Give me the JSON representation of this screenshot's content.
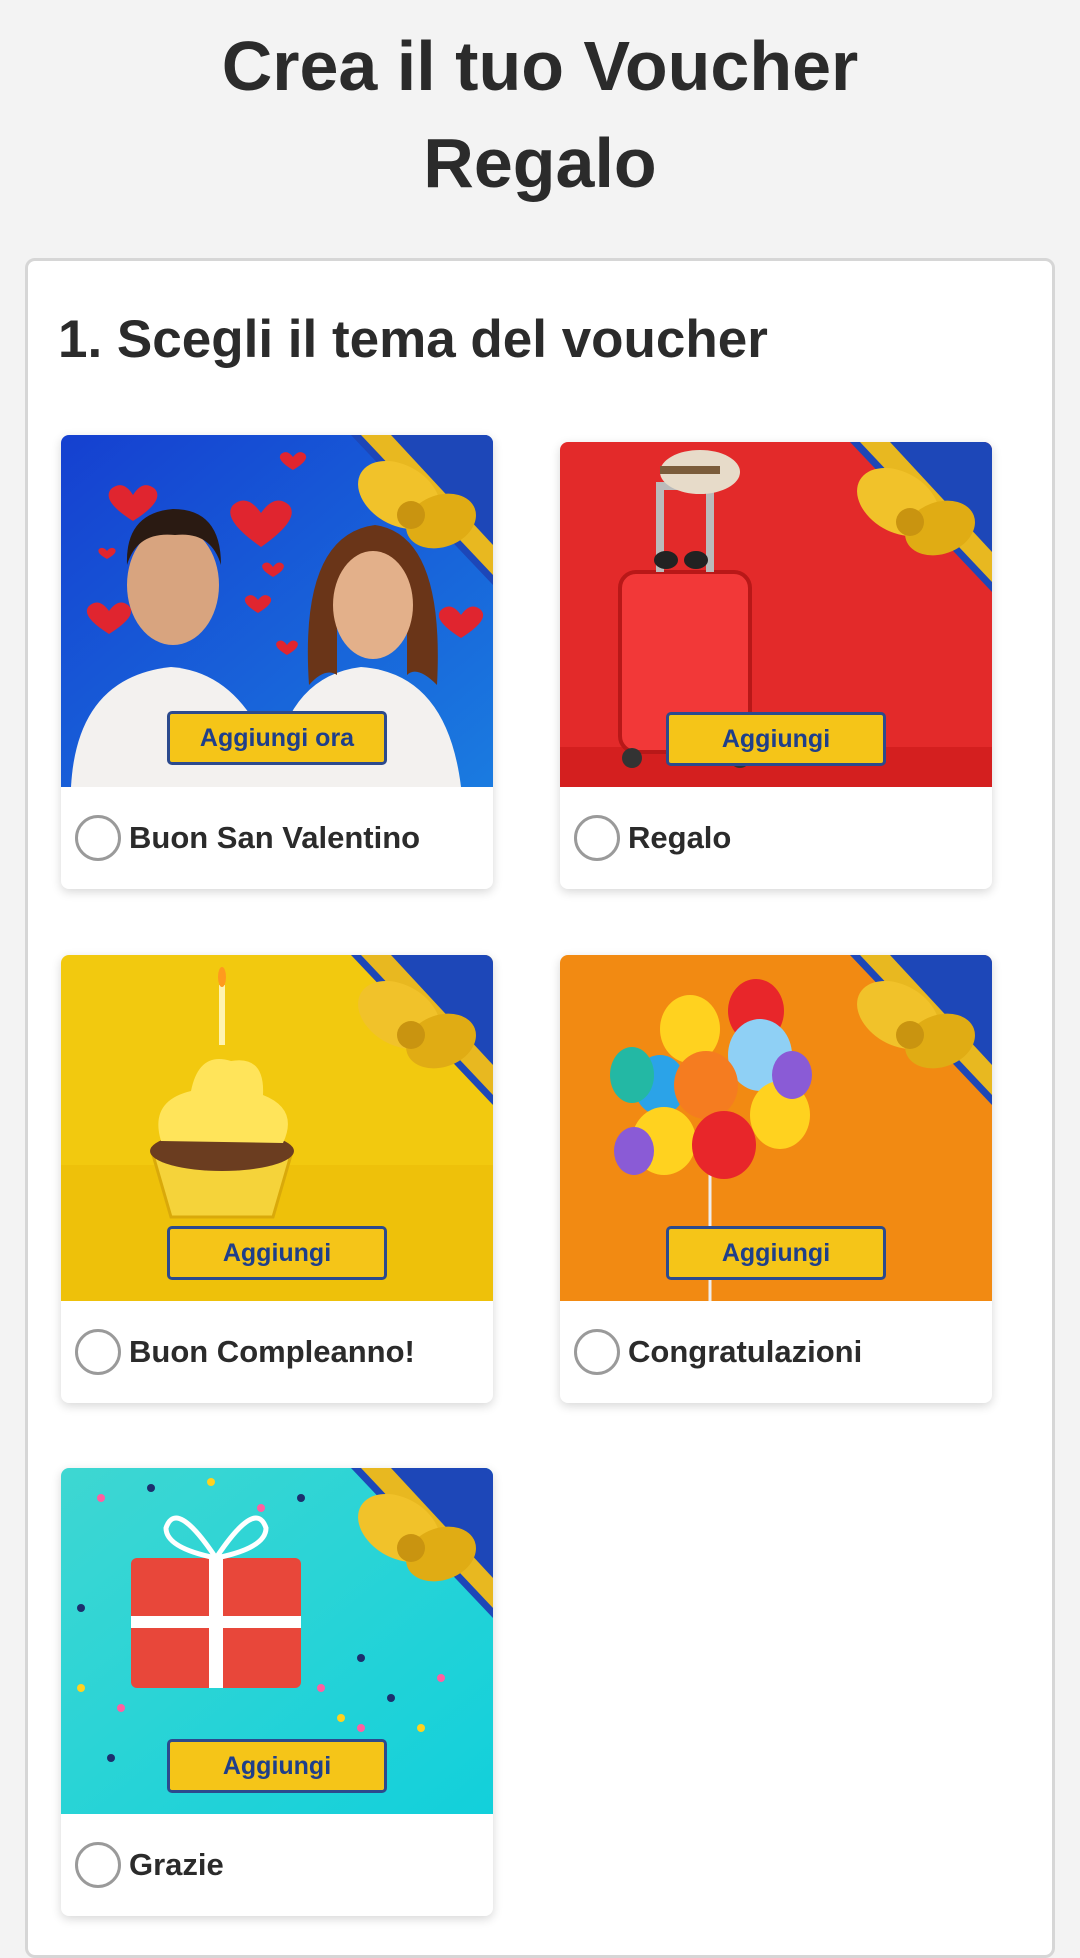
{
  "page": {
    "title_line1": "Crea il tuo Voucher",
    "title_line2": "Regalo"
  },
  "section": {
    "title": "1. Scegli il tema del voucher"
  },
  "themes": [
    {
      "label": "Buon San Valentino",
      "cta": "Aggiungi ora",
      "background": "#1b63d6"
    },
    {
      "label": "Regalo",
      "cta": "Aggiungi",
      "background": "#e32a2a"
    },
    {
      "label": "Buon Compleanno!",
      "cta": "Aggiungi",
      "background": "#f2c90f"
    },
    {
      "label": "Congratulazioni",
      "cta": "Aggiungi",
      "background": "#f28a12"
    },
    {
      "label": "Grazie",
      "cta": "Aggiungi",
      "background": "#22d4d4"
    }
  ],
  "colors": {
    "button_fill": "#f5c518",
    "button_border": "#2c4a8d",
    "ribbon": "#e8b820",
    "corner": "#1d47b8"
  }
}
